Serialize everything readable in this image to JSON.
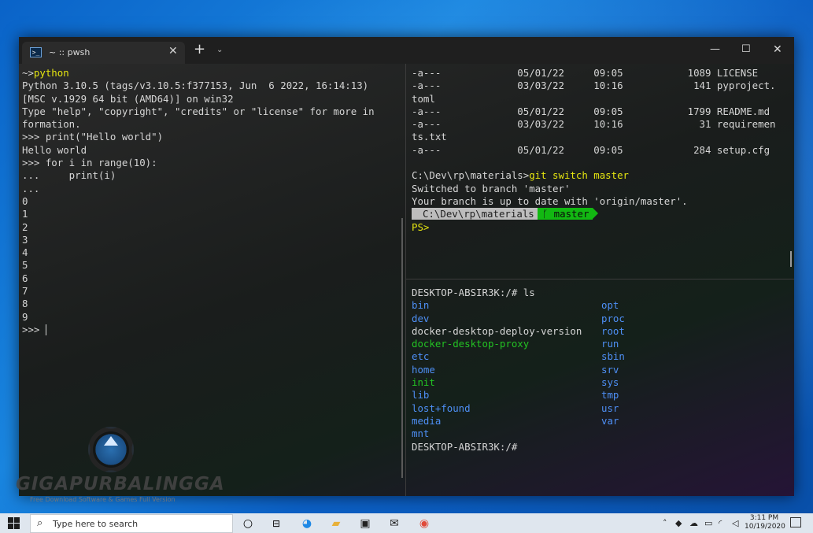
{
  "colors": {
    "prompt_yellow": "#e5e510",
    "dir_blue": "#4e8ff5",
    "exec_green": "#23c223",
    "git_green": "#12b812",
    "path_grey": "#bdbdbd"
  },
  "tab": {
    "title": "~ :: pwsh",
    "icon": "powershell-icon",
    "close": "✕",
    "new": "+",
    "dropdown": "⌄"
  },
  "window_controls": {
    "minimize": "—",
    "maximize": "☐",
    "close": "✕"
  },
  "left_pane": {
    "lines": [
      {
        "prompt": "~>",
        "cmd": "python"
      },
      {
        "text": "Python 3.10.5 (tags/v3.10.5:f377153, Jun  6 2022, 16:14:13)"
      },
      {
        "text": "[MSC v.1929 64 bit (AMD64)] on win32"
      },
      {
        "text": "Type \"help\", \"copyright\", \"credits\" or \"license\" for more in"
      },
      {
        "text": "formation."
      },
      {
        "text": ">>> print(\"Hello world\")"
      },
      {
        "text": "Hello world"
      },
      {
        "text": ">>> for i in range(10):"
      },
      {
        "text": "...     print(i)"
      },
      {
        "text": "..."
      },
      {
        "text": "0"
      },
      {
        "text": "1"
      },
      {
        "text": "2"
      },
      {
        "text": "3"
      },
      {
        "text": "4"
      },
      {
        "text": "5"
      },
      {
        "text": "6"
      },
      {
        "text": "7"
      },
      {
        "text": "8"
      },
      {
        "text": "9"
      }
    ],
    "final_prompt": ">>> "
  },
  "right_top_pane": {
    "files": [
      {
        "mode": "-a---",
        "date": "05/01/22",
        "time": "09:05",
        "size": "1089",
        "name": "LICENSE"
      },
      {
        "mode": "-a---",
        "date": "03/03/22",
        "time": "10:16",
        "size": "141",
        "name": "pyproject."
      },
      {
        "wrap": "toml"
      },
      {
        "mode": "-a---",
        "date": "05/01/22",
        "time": "09:05",
        "size": "1799",
        "name": "README.md"
      },
      {
        "mode": "-a---",
        "date": "03/03/22",
        "time": "10:16",
        "size": "31",
        "name": "requiremen"
      },
      {
        "wrap": "ts.txt"
      },
      {
        "mode": "-a---",
        "date": "05/01/22",
        "time": "09:05",
        "size": "284",
        "name": "setup.cfg"
      }
    ],
    "cmd_prefix": "C:\\Dev\\rp\\materials>",
    "cmd": "git switch master",
    "out1": "Switched to branch 'master'",
    "out2": "Your branch is up to date with 'origin/master'.",
    "prompt_path": "C:\\Dev\\rp\\materials",
    "branch_icon": "branch-icon",
    "branch_glyph": "ᚴ",
    "branch": "master",
    "ps_prompt": "PS>"
  },
  "right_bottom_pane": {
    "cmd_line": "DESKTOP-ABSIR3K:/# ls",
    "col1": [
      {
        "name": "bin",
        "kind": "dir"
      },
      {
        "name": "dev",
        "kind": "dir"
      },
      {
        "name": "docker-desktop-deploy-version",
        "kind": "file"
      },
      {
        "name": "docker-desktop-proxy",
        "kind": "exec"
      },
      {
        "name": "etc",
        "kind": "dir"
      },
      {
        "name": "home",
        "kind": "dir"
      },
      {
        "name": "init",
        "kind": "exec"
      },
      {
        "name": "lib",
        "kind": "dir"
      },
      {
        "name": "lost+found",
        "kind": "dir"
      },
      {
        "name": "media",
        "kind": "dir"
      },
      {
        "name": "mnt",
        "kind": "dir"
      }
    ],
    "col2": [
      {
        "name": "opt",
        "kind": "dir"
      },
      {
        "name": "proc",
        "kind": "dir"
      },
      {
        "name": "root",
        "kind": "dir"
      },
      {
        "name": "run",
        "kind": "dir"
      },
      {
        "name": "sbin",
        "kind": "dir"
      },
      {
        "name": "srv",
        "kind": "dir"
      },
      {
        "name": "sys",
        "kind": "dir"
      },
      {
        "name": "tmp",
        "kind": "dir"
      },
      {
        "name": "usr",
        "kind": "dir"
      },
      {
        "name": "var",
        "kind": "dir"
      }
    ],
    "final_prompt": "DESKTOP-ABSIR3K:/#"
  },
  "watermark": {
    "title": "GIGAPURBALINGGA",
    "subtitle": "Free Download Software & Games Full Version"
  },
  "taskbar": {
    "search_placeholder": "Type here to search",
    "apps": [
      "task-view-icon",
      "edge-icon",
      "file-explorer-icon",
      "store-icon",
      "mail-icon",
      "chrome-icon"
    ],
    "clock_time": "3:11 PM",
    "clock_date": "10/19/2020"
  }
}
